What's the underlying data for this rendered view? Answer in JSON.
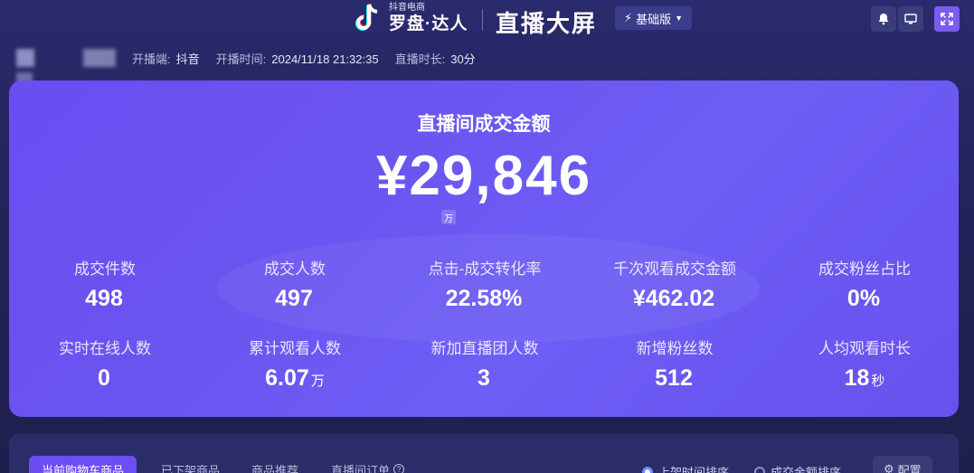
{
  "header": {
    "brand_small": "抖音电商",
    "brand_big": "罗盘·达人",
    "screen_title": "直播大屏",
    "edition": "基础版"
  },
  "info": {
    "platform_label": "开播端:",
    "platform_value": "抖音",
    "start_label": "开播时间:",
    "start_value": "2024/11/18 21:32:35",
    "duration_label": "直播时长:",
    "duration_value": "30分"
  },
  "main": {
    "title": "直播间成交金额",
    "gmv": "¥29,846",
    "gmv_unit": "万"
  },
  "metrics": [
    {
      "label": "成交件数",
      "value": "498",
      "unit": ""
    },
    {
      "label": "成交人数",
      "value": "497",
      "unit": ""
    },
    {
      "label": "点击-成交转化率",
      "value": "22.58%",
      "unit": ""
    },
    {
      "label": "千次观看成交金额",
      "value": "¥462.02",
      "unit": ""
    },
    {
      "label": "成交粉丝占比",
      "value": "0%",
      "unit": ""
    },
    {
      "label": "实时在线人数",
      "value": "0",
      "unit": ""
    },
    {
      "label": "累计观看人数",
      "value": "6.07",
      "unit": "万"
    },
    {
      "label": "新加直播团人数",
      "value": "3",
      "unit": ""
    },
    {
      "label": "新增粉丝数",
      "value": "512",
      "unit": ""
    },
    {
      "label": "人均观看时长",
      "value": "18",
      "unit": "秒"
    }
  ],
  "tabs": [
    "当前购物车商品",
    "已下架商品",
    "商品推荐",
    "直播间订单"
  ],
  "sort": {
    "option1": "上架时间排序",
    "option2": "成交金额排序",
    "selected": "上架时间排序"
  },
  "config_label": "配置",
  "colors": {
    "accent": "#6b4df2",
    "background": "#23245a"
  }
}
